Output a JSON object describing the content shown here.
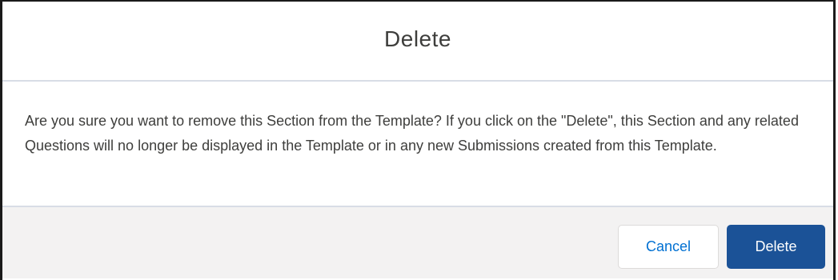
{
  "dialog": {
    "title": "Delete",
    "message": "Are you sure you want to remove this Section from the Template? If you click on the \"Delete\", this Section and any related Questions will no longer be displayed in the Template or in any new Submissions created from this Template.",
    "buttons": {
      "cancel_label": "Cancel",
      "delete_label": "Delete"
    }
  }
}
